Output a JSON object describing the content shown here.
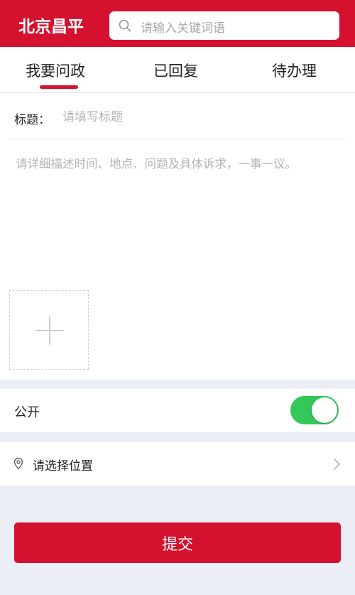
{
  "header": {
    "logo_text": "北京昌平",
    "search_placeholder": "请输入关键词语",
    "brand_color": "#d4112f"
  },
  "tabs": [
    {
      "label": "我要问政",
      "active": true
    },
    {
      "label": "已回复",
      "active": false
    },
    {
      "label": "待办理",
      "active": false
    }
  ],
  "form": {
    "title_label": "标题：",
    "title_placeholder": "请填写标题",
    "description_placeholder": "请详细描述时间、地点、问题及具体诉求，一事一议。",
    "upload_icon": "plus-icon"
  },
  "public": {
    "label": "公开",
    "enabled": true,
    "toggle_color": "#34c759"
  },
  "location": {
    "label": "请选择位置",
    "icon": "location-pin-icon"
  },
  "submit": {
    "label": "提交"
  }
}
